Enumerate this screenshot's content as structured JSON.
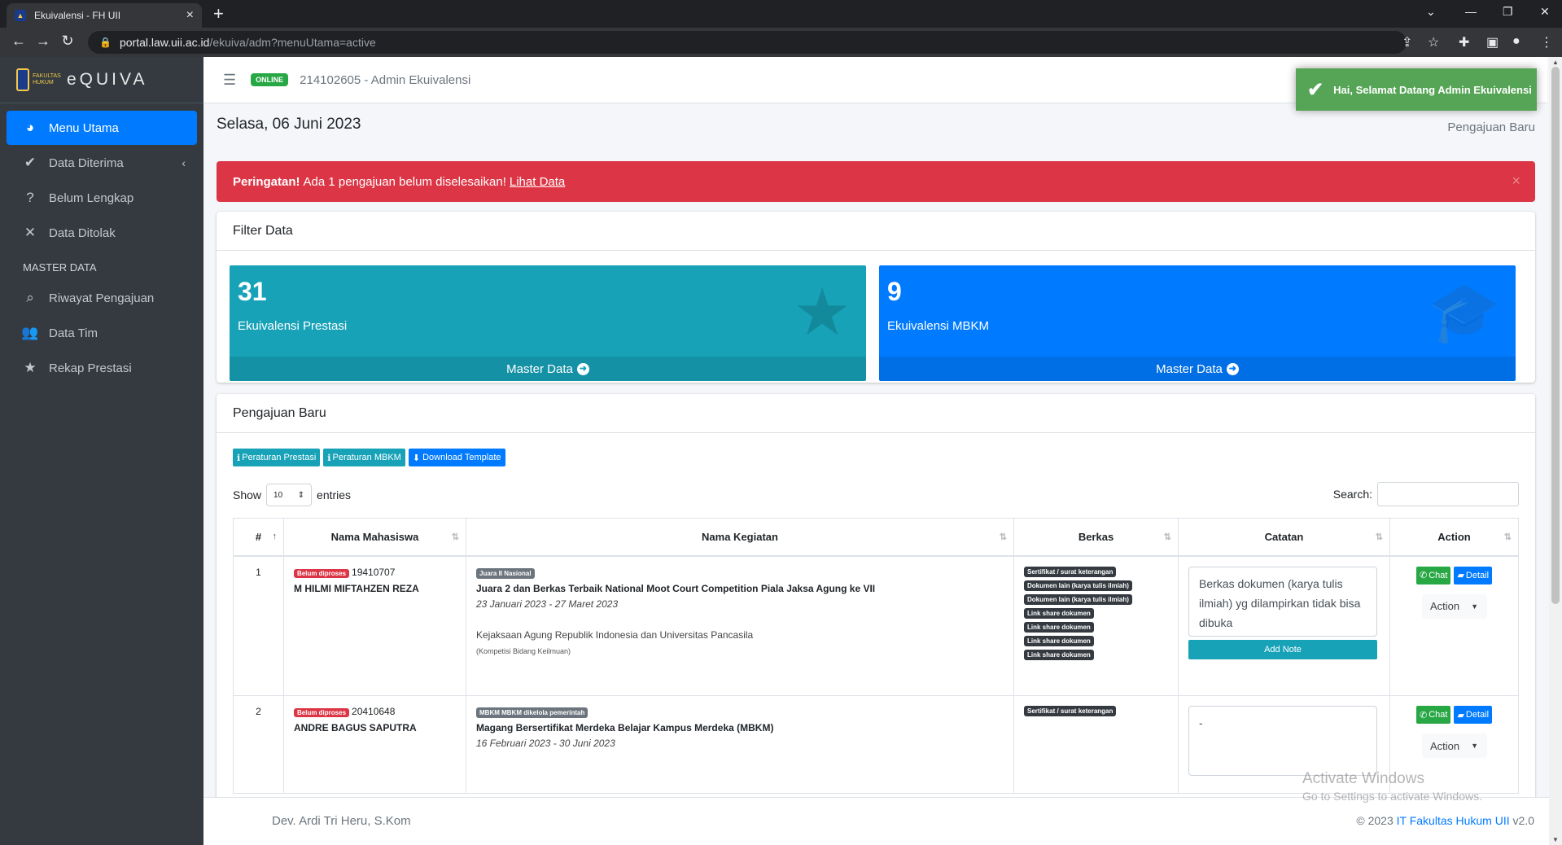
{
  "browser": {
    "tab_title": "Ekuivalensi - FH UII",
    "url_host": "portal.law.uii.ac.id",
    "url_path": "/ekuiva/adm?menuUtama=active"
  },
  "sidebar": {
    "brand": "eQUIVA",
    "logo_text": "FAKULTAS HUKUM",
    "items": [
      {
        "label": "Menu Utama",
        "icon": "dashboard-icon"
      },
      {
        "label": "Data Diterima",
        "icon": "check-icon"
      },
      {
        "label": "Belum Lengkap",
        "icon": "question-icon"
      },
      {
        "label": "Data Ditolak",
        "icon": "x-icon"
      }
    ],
    "section_header": "MASTER DATA",
    "master_items": [
      {
        "label": "Riwayat Pengajuan",
        "icon": "search-icon"
      },
      {
        "label": "Data Tim",
        "icon": "users-icon"
      },
      {
        "label": "Rekap Prestasi",
        "icon": "star-icon"
      }
    ]
  },
  "topnav": {
    "status_badge": "ONLINE",
    "user": "214102605 - Admin Ekuivalensi",
    "admin_ghost": "Admin"
  },
  "toast": {
    "message": "Hai, Selamat Datang Admin Ekuivalensi"
  },
  "header": {
    "date": "Selasa, 06 Juni 2023",
    "breadcrumb": "Pengajuan Baru"
  },
  "alert": {
    "strong": "Peringatan!",
    "text": "Ada 1 pengajuan belum diselesaikan!",
    "link": "Lihat Data",
    "close": "×"
  },
  "filter": {
    "title": "Filter Data",
    "boxes": [
      {
        "count": "31",
        "label": "Ekuivalensi Prestasi",
        "footer": "Master Data",
        "color": "#17a2b8",
        "icon": "star-icon"
      },
      {
        "count": "9",
        "label": "Ekuivalensi MBKM",
        "footer": "Master Data",
        "color": "#007bff",
        "icon": "graduation-cap-icon"
      }
    ]
  },
  "pengajuan": {
    "title": "Pengajuan Baru",
    "buttons": [
      "Peraturan Prestasi",
      "Peraturan MBKM",
      "Download Template"
    ],
    "show_label": "Show",
    "entries_value": "10",
    "entries_label": "entries",
    "search_label": "Search:",
    "columns": [
      "#",
      "Nama Mahasiswa",
      "Nama Kegiatan",
      "Berkas",
      "Catatan",
      "Action"
    ],
    "rows": [
      {
        "no": "1",
        "status": "Belum diproses",
        "nim": "19410707",
        "name": "M HILMI MIFTAHZEN REZA",
        "kegiatan_tag": "Juara II Nasional",
        "kegiatan": "Juara 2 dan Berkas Terbaik National Moot Court Competition Piala Jaksa Agung ke VII",
        "tanggal": "23 Januari 2023 - 27 Maret 2023",
        "penyelenggara": "Kejaksaan Agung Republik Indonesia dan Universitas Pancasila",
        "kategori": "(Kompetisi Bidang Keilmuan)",
        "berkas": [
          "Sertifikat / surat keterangan",
          "Dokumen lain (karya tulis ilmiah)",
          "Dokumen lain (karya tulis ilmiah)",
          "Link share dokumen",
          "Link share dokumen",
          "Link share dokumen",
          "Link share dokumen"
        ],
        "catatan": "Berkas dokumen (karya tulis ilmiah) yg dilampirkan tidak bisa dibuka",
        "add_note": "Add Note",
        "chat": "Chat",
        "detail": "Detail",
        "action": "Action"
      },
      {
        "no": "2",
        "status": "Belum diproses",
        "nim": "20410648",
        "name": "ANDRE BAGUS SAPUTRA",
        "kegiatan_tag": "MBKM MBKM dikelola pemerintah",
        "kegiatan": "Magang Bersertifikat Merdeka Belajar Kampus Merdeka (MBKM)",
        "tanggal": "16 Februari 2023 - 30 Juni 2023",
        "berkas": [
          "Sertifikat / surat keterangan"
        ],
        "catatan": "-",
        "chat": "Chat",
        "detail": "Detail",
        "action": "Action"
      }
    ]
  },
  "footer": {
    "left": "Dev. Ardi Tri Heru, S.Kom",
    "right_prefix": "© 2023",
    "right_link": "IT Fakultas Hukum UII",
    "right_suffix": "v2.0"
  },
  "watermark": {
    "line1": "Activate Windows",
    "line2": "Go to Settings to activate Windows."
  }
}
